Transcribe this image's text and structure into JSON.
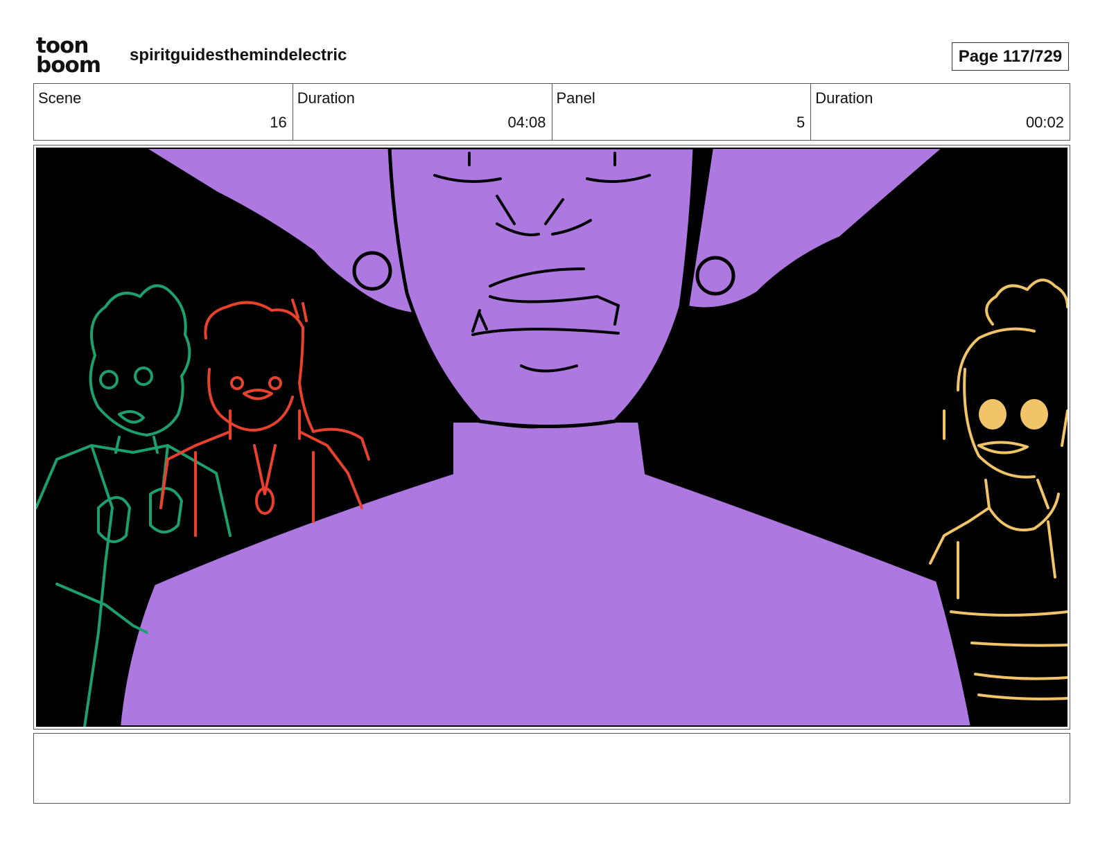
{
  "header": {
    "logo_top": "toon",
    "logo_bottom": "boom",
    "project_title": "spiritguidesthemindelectric",
    "page_label": "Page 117/729"
  },
  "info": [
    {
      "label": "Scene",
      "value": "16"
    },
    {
      "label": "Duration",
      "value": "04:08"
    },
    {
      "label": "Panel",
      "value": "5"
    },
    {
      "label": "Duration",
      "value": "00:02"
    }
  ],
  "panel": {
    "colors": {
      "background": "#000000",
      "purple_figure": "#ad78e0",
      "green_character": "#1e9f6e",
      "red_character": "#e8422e",
      "yellow_character": "#f2c46a",
      "ink": "#000000"
    }
  },
  "notes": {
    "text": ""
  }
}
